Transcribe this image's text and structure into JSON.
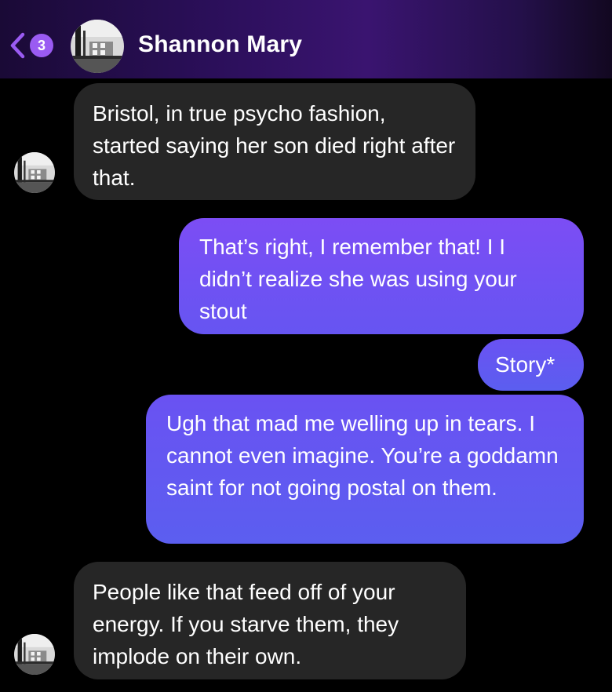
{
  "header": {
    "back_badge_count": "3",
    "contact_name": "Shannon Mary",
    "icons": [
      "chevron-left-icon",
      "avatar"
    ]
  },
  "messages": [
    {
      "direction": "incoming",
      "text": "Bristol, in true psycho fashion, started saying her son died right after that."
    },
    {
      "direction": "outgoing",
      "text": "That’s right, I remember that! I I didn’t realize she was using your stout"
    },
    {
      "direction": "outgoing",
      "text": "Story*"
    },
    {
      "direction": "outgoing",
      "text": "Ugh that mad me welling up in tears. I cannot even imagine. You’re a goddamn saint for not going postal on them."
    },
    {
      "direction": "incoming",
      "text": "People like that feed off of your energy. If you starve them, they implode on their own."
    }
  ],
  "colors": {
    "incoming_bubble": "#262626",
    "outgoing_top": "#7c4df4",
    "outgoing_bottom": "#5b5ef0",
    "badge": "#9a5bf2",
    "background": "#000000"
  }
}
